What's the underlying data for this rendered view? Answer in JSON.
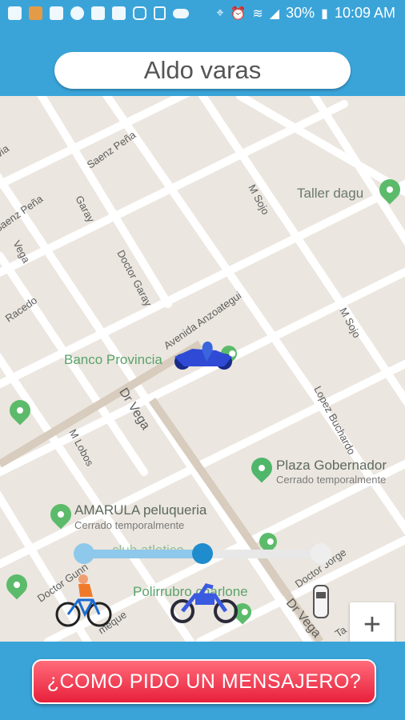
{
  "status_bar": {
    "battery": "30%",
    "time": "10:09 AM",
    "icons": [
      "app-icon",
      "notification-icon",
      "mail-icon",
      "messenger-icon",
      "app-icon",
      "gallery-icon",
      "instagram-icon",
      "prescription-icon",
      "cloud-icon",
      "location-icon",
      "alarm-icon",
      "wifi-icon",
      "signal-icon",
      "battery-icon"
    ]
  },
  "header": {
    "user_name": "Aldo varas"
  },
  "map": {
    "streets": [
      "Saenz Peña",
      "Saenz Peña",
      "Garay",
      "Vega",
      "Racedo",
      "Doctor Garay",
      "Avenida Anzoategui",
      "M Sojo",
      "M Sojo",
      "Dr Vega",
      "M Lobos",
      "Lopez Buchardo",
      "Doctor Jorge",
      "Doctor Gunn",
      "Dr Vega",
      "via",
      "meque",
      "Ta"
    ],
    "places": [
      {
        "name": "Taller dagu",
        "sub": ""
      },
      {
        "name": "Banco Provincia",
        "sub": ""
      },
      {
        "name": "Plaza Gobernador",
        "sub": "Cerrado temporalmente"
      },
      {
        "name": "AMARULA peluqueria",
        "sub": "Cerrado temporalmente"
      },
      {
        "name": "club atletico",
        "sub": ""
      },
      {
        "name": "Polirrubro charlone",
        "sub": ""
      }
    ],
    "zoom_in_label": "+"
  },
  "vehicle_slider": {
    "options": [
      "bicycle",
      "motorcycle",
      "car"
    ],
    "selected_index": 1,
    "colors": {
      "active": "#1f8ccd",
      "inactive": "#e8e8e8",
      "start": "#8ec8ea"
    }
  },
  "footer": {
    "cta_label": "¿COMO PIDO UN MENSAJERO?"
  }
}
